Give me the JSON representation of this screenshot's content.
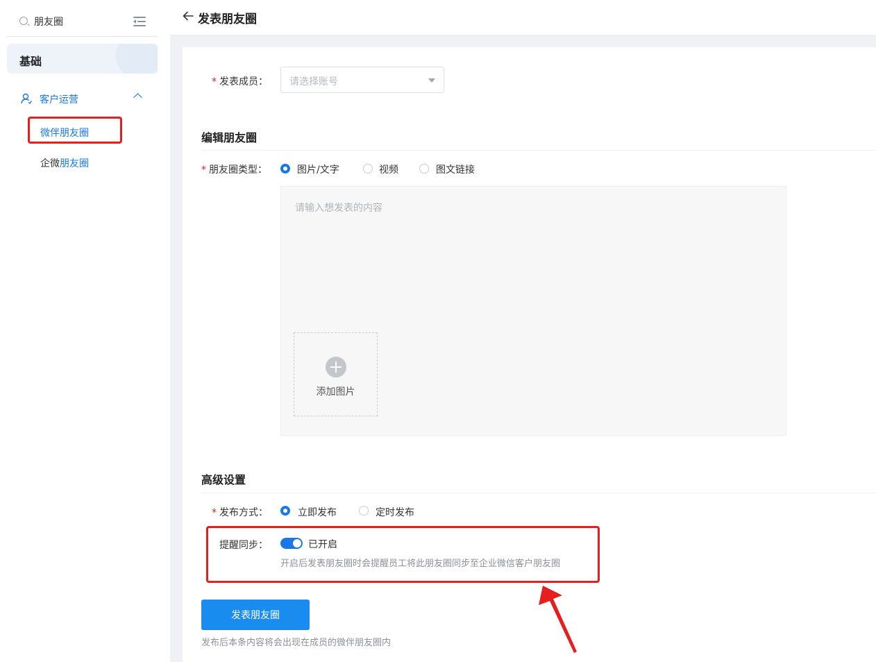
{
  "sidebar": {
    "search": {
      "value": "朋友圈"
    },
    "section_title": "基础",
    "group": {
      "label": "客户运营"
    },
    "items": [
      {
        "label": "微伴朋友圈"
      },
      {
        "label_prefix": "企微",
        "label_highlight": "朋友圈"
      }
    ]
  },
  "header": {
    "title": "发表朋友圈"
  },
  "form": {
    "member": {
      "label": "发表成员：",
      "placeholder": "请选择账号"
    },
    "edit_section": {
      "title": "编辑朋友圈"
    },
    "moment_type": {
      "label": "朋友圈类型：",
      "options": [
        "图片/文字",
        "视频",
        "图文链接"
      ],
      "selected": "图片/文字"
    },
    "content": {
      "placeholder": "请输入想发表的内容"
    },
    "upload": {
      "label": "添加图片"
    },
    "advanced_section": {
      "title": "高级设置"
    },
    "publish_mode": {
      "label": "发布方式：",
      "options": [
        "立即发布",
        "定时发布"
      ],
      "selected": "立即发布"
    },
    "reminder_sync": {
      "label": "提醒同步：",
      "status": "已开启",
      "enabled": true,
      "hint": "开启后发表朋友圈时会提醒员工将此朋友圈同步至企业微信客户朋友圈"
    },
    "submit": {
      "label": "发表朋友圈",
      "hint": "发布后本条内容将会出现在成员的微伴朋友圈内"
    }
  },
  "colors": {
    "accent": "#1a78e6",
    "button": "#1a8cf0",
    "annotation": "#e61e1e"
  }
}
